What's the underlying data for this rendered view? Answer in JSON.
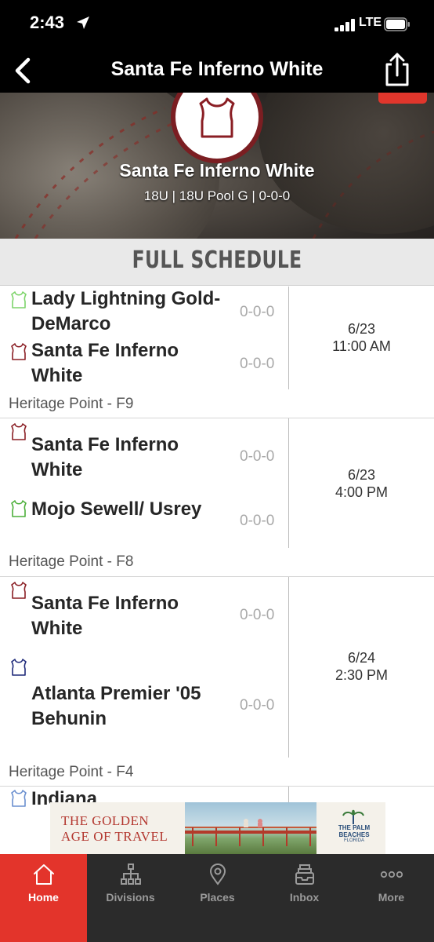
{
  "status_bar": {
    "time": "2:43",
    "network": "LTE"
  },
  "nav": {
    "title": "Santa Fe Inferno White"
  },
  "team_header": {
    "name": "Santa Fe Inferno White",
    "meta": "18U | 18U Pool G | 0-0-0"
  },
  "schedule": {
    "title": "FULL SCHEDULE",
    "games": [
      {
        "team1": "Lady Lightning Gold-DeMarco",
        "team1_record": "0-0-0",
        "team1_color": "#7dd46a",
        "team2": "Santa Fe Inferno White",
        "team2_record": "0-0-0",
        "team2_color": "#8a1e24",
        "date": "6/23",
        "time": "11:00 AM",
        "venue": "Heritage Point - F9"
      },
      {
        "team1": "Santa Fe Inferno White",
        "team1_record": "0-0-0",
        "team1_color": "#8a1e24",
        "team2": "Mojo Sewell/ Usrey",
        "team2_record": "0-0-0",
        "team2_color": "#4caf3a",
        "date": "6/23",
        "time": "4:00 PM",
        "venue": "Heritage Point - F8"
      },
      {
        "team1": "Santa Fe Inferno White",
        "team1_record": "0-0-0",
        "team1_color": "#8a1e24",
        "team2": "Atlanta Premier '05 Behunin",
        "team2_record": "0-0-0",
        "team2_color": "#1f2a7a",
        "date": "6/24",
        "time": "2:30 PM",
        "venue": "Heritage Point - F4"
      },
      {
        "team1": "Indiana",
        "team1_color": "#6a8fcf"
      }
    ]
  },
  "ad": {
    "line1": "THE GOLDEN",
    "line2": "AGE OF TRAVEL",
    "brand": "THE PALM BEACHES",
    "brand_sub": "FLORIDA"
  },
  "tabs": [
    {
      "label": "Home",
      "icon": "home-icon",
      "active": true
    },
    {
      "label": "Divisions",
      "icon": "bracket-icon",
      "active": false
    },
    {
      "label": "Places",
      "icon": "map-pin-icon",
      "active": false
    },
    {
      "label": "Inbox",
      "icon": "inbox-icon",
      "active": false
    },
    {
      "label": "More",
      "icon": "more-dots-icon",
      "active": false
    }
  ]
}
